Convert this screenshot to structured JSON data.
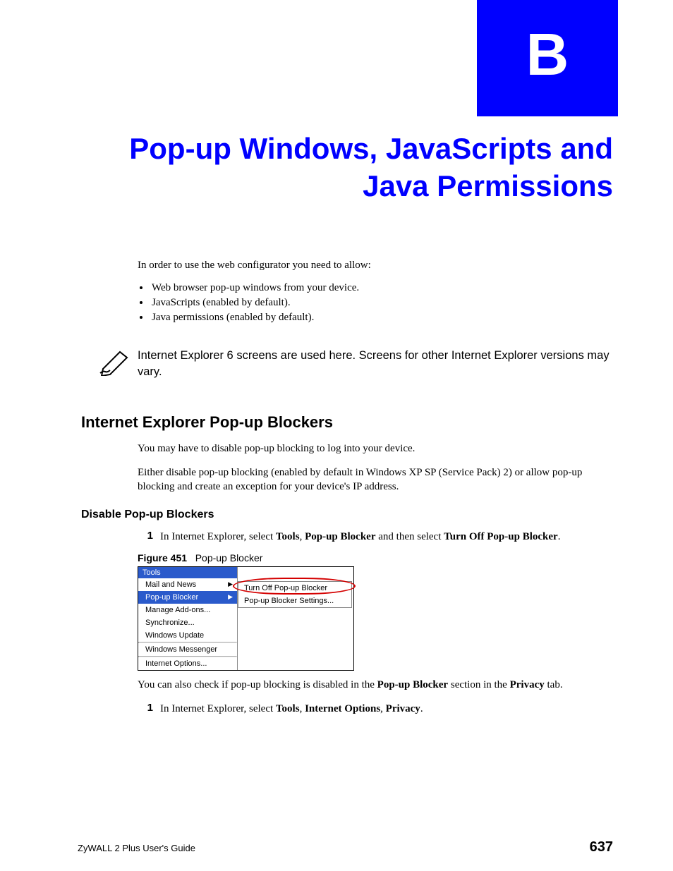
{
  "appendix_letter": "B",
  "title": "Pop-up Windows, JavaScripts and Java Permissions",
  "intro_para": "In order to use the web configurator you need to allow:",
  "intro_list": [
    "Web browser pop-up windows from your device.",
    "JavaScripts (enabled by default).",
    "Java permissions (enabled by default)."
  ],
  "note_text": "Internet Explorer 6 screens are used here. Screens for other Internet Explorer versions may vary.",
  "section1_heading": "Internet Explorer Pop-up Blockers",
  "section1_p1": "You may have to disable pop-up blocking to log into your device.",
  "section1_p2": "Either disable pop-up blocking (enabled by default in Windows XP SP (Service Pack) 2) or allow pop-up blocking and create an exception for your device's IP address.",
  "subsection_heading": "Disable Pop-up Blockers",
  "step1": {
    "num": "1",
    "pre": "In Internet Explorer, select ",
    "b1": "Tools",
    "sep1": ", ",
    "b2": "Pop-up Blocker",
    "mid": " and then select ",
    "b3": "Turn Off Pop-up Blocker",
    "post": "."
  },
  "figure": {
    "label": "Figure 451",
    "caption": "Pop-up Blocker",
    "menu_header": "Tools",
    "menu_items": [
      {
        "label": "Mail and News",
        "has_arrow": true,
        "selected": false
      },
      {
        "label": "Pop-up Blocker",
        "has_arrow": true,
        "selected": true
      },
      {
        "label": "Manage Add-ons...",
        "has_arrow": false,
        "selected": false
      },
      {
        "label": "Synchronize...",
        "has_arrow": false,
        "selected": false
      },
      {
        "label": "Windows Update",
        "has_arrow": false,
        "selected": false
      },
      {
        "label": "Windows Messenger",
        "has_arrow": false,
        "selected": false,
        "sep_before": true
      },
      {
        "label": "Internet Options...",
        "has_arrow": false,
        "selected": false,
        "sep_before": true
      }
    ],
    "submenu": [
      "Turn Off Pop-up Blocker",
      "Pop-up Blocker Settings..."
    ]
  },
  "after_fig_para": {
    "pre": "You can also check if pop-up blocking is disabled in the ",
    "b1": "Pop-up Blocker",
    "mid": " section in the ",
    "b2": "Privacy",
    "post": " tab."
  },
  "step2": {
    "num": "1",
    "pre": "In Internet Explorer, select ",
    "b1": "Tools",
    "sep1": ", ",
    "b2": "Internet Options",
    "sep2": ", ",
    "b3": "Privacy",
    "post": "."
  },
  "footer": {
    "guide": "ZyWALL 2 Plus User's Guide",
    "page": "637"
  }
}
